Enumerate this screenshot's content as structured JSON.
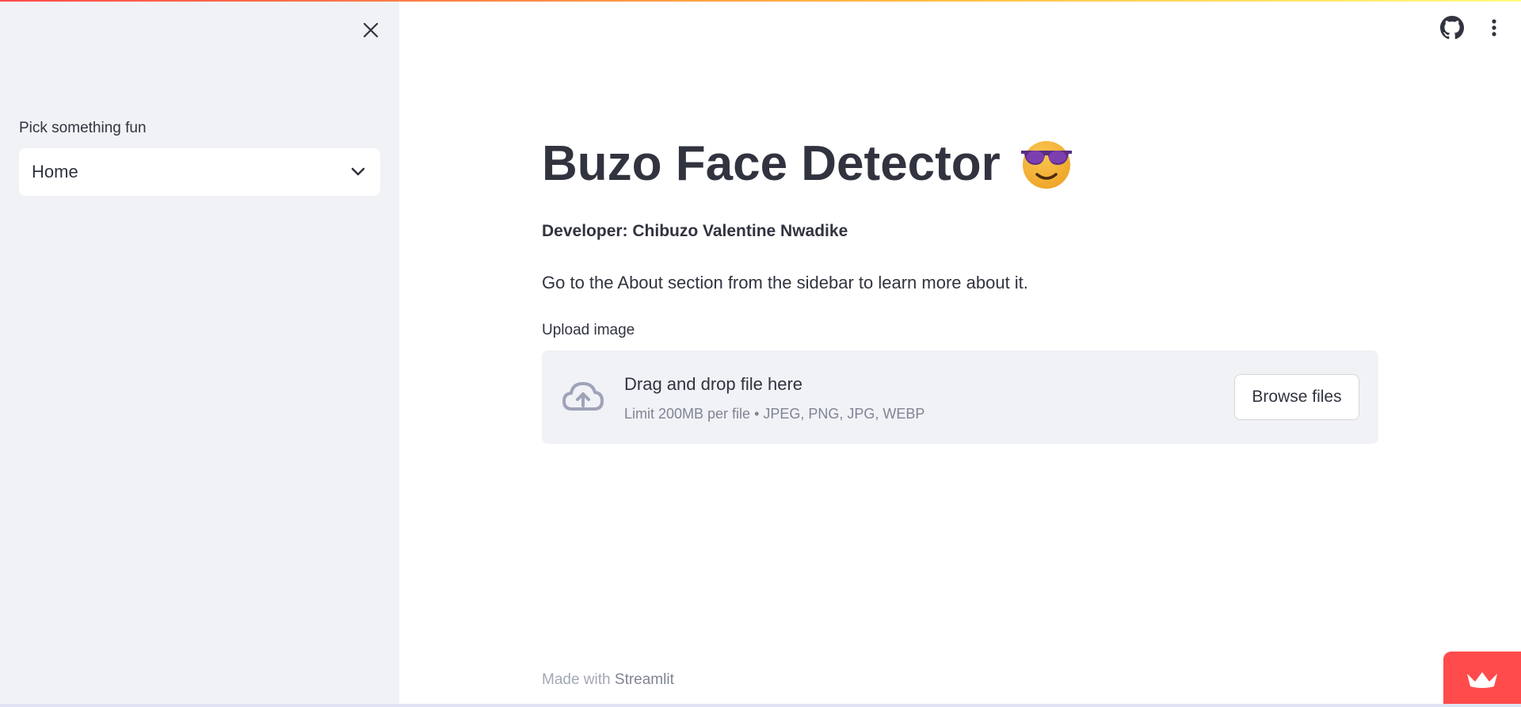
{
  "sidebar": {
    "label": "Pick something fun",
    "select_value": "Home",
    "close_icon": "close-icon",
    "chevron_icon": "chevron-down-icon"
  },
  "header": {
    "github_icon": "github-icon",
    "menu_icon": "more-vert-icon"
  },
  "main": {
    "title": "Buzo Face Detector",
    "title_emoji": "sunglasses-face-emoji",
    "developer": "Developer: Chibuzo Valentine Nwadike",
    "description": "Go to the About section from the sidebar to learn more about it.",
    "upload": {
      "label": "Upload image",
      "drop_title": "Drag and drop file here",
      "drop_subtitle": "Limit 200MB per file • JPEG, PNG, JPG, WEBP",
      "browse_label": "Browse files",
      "icon": "cloud-upload-icon"
    }
  },
  "footer": {
    "prefix": "Made with",
    "brand": "Streamlit"
  },
  "colors": {
    "accent": "#ff4b4b",
    "sidebar_bg": "#f0f2f6",
    "text": "#31333f",
    "muted": "#808495"
  }
}
